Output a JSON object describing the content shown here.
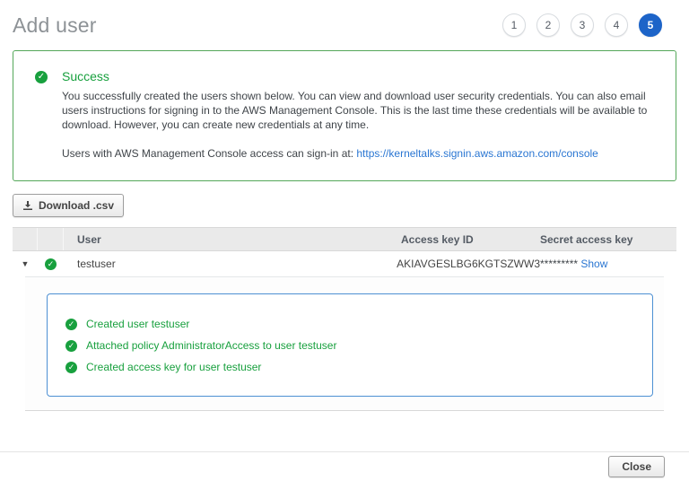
{
  "header": {
    "title": "Add user",
    "steps": [
      "1",
      "2",
      "3",
      "4",
      "5"
    ],
    "active_step": "5"
  },
  "banner": {
    "title": "Success",
    "body": "You successfully created the users shown below. You can view and download user security credentials. You can also email users instructions for signing in to the AWS Management Console. This is the last time these credentials will be available to download. However, you can create new credentials at any time.",
    "signin_prefix": "Users with AWS Management Console access can sign-in at: ",
    "signin_url": "https://kerneltalks.signin.aws.amazon.com/console"
  },
  "toolbar": {
    "download_label": "Download .csv"
  },
  "table": {
    "headers": {
      "user": "User",
      "access_key_id": "Access key ID",
      "secret_access_key": "Secret access key"
    },
    "row": {
      "user": "testuser",
      "access_key_id": "AKIAVGESLBG6KGTSZWW3",
      "secret_masked": "*********",
      "show_label": "Show"
    }
  },
  "details": {
    "items": [
      "Created user testuser",
      "Attached policy AdministratorAccess to user testuser",
      "Created access key for user testuser"
    ]
  },
  "footer": {
    "close_label": "Close"
  },
  "colors": {
    "success_green": "#18a03e",
    "success_border": "#54a759",
    "active_step_blue": "#1d64c8",
    "link_blue": "#2a76d2",
    "detail_box_border": "#4d90d3"
  }
}
